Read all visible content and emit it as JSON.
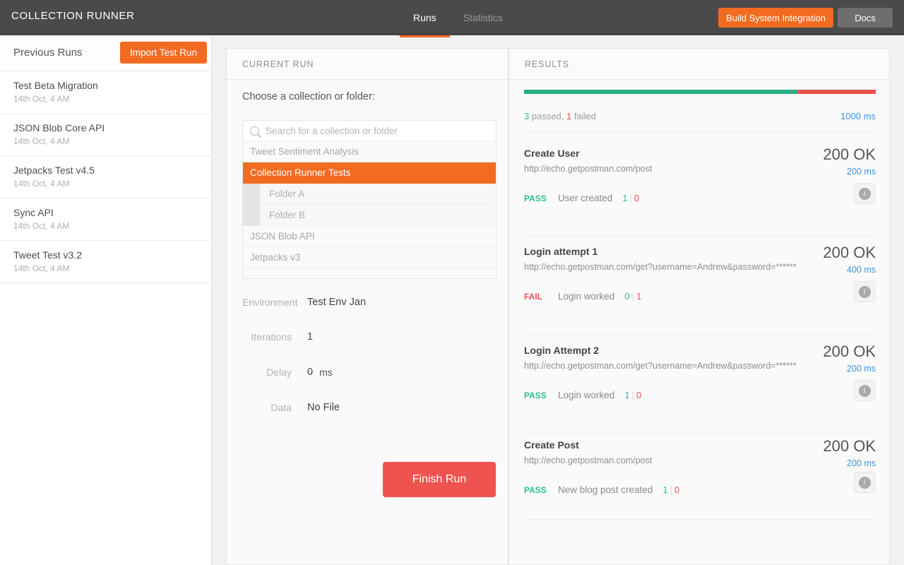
{
  "app": {
    "title": "COLLECTION RUNNER"
  },
  "header": {
    "tabs": [
      {
        "label": "Runs",
        "active": true
      },
      {
        "label": "Statistics",
        "active": false
      }
    ],
    "build_button": "Build System Integration",
    "docs_button": "Docs",
    "accent_color": "#f26b21",
    "background_color": "#4a4a4a"
  },
  "sidebar": {
    "title": "Previous Runs",
    "import_button": "Import Test Run",
    "runs": [
      {
        "name": "Test Beta Migration",
        "date": "14th Oct, 4 AM"
      },
      {
        "name": "JSON Blob Core API",
        "date": "14th Oct, 4 AM"
      },
      {
        "name": "Jetpacks Test v4.5",
        "date": "14th Oct, 4 AM"
      },
      {
        "name": "Sync API",
        "date": "14th Oct, 4 AM"
      },
      {
        "name": "Tweet Test v3.2",
        "date": "14th Oct, 4 AM"
      }
    ]
  },
  "current_run": {
    "panel_title": "CURRENT RUN",
    "choose_label": "Choose a collection or folder:",
    "search_placeholder": "Search for a collection or folder",
    "search_value": "",
    "collections": [
      {
        "label": "Tweet Sentiment Analysis",
        "type": "collection",
        "selected": false
      },
      {
        "label": "Collection Runner Tests",
        "type": "collection",
        "selected": true
      },
      {
        "label": "Folder A",
        "type": "folder",
        "selected": false
      },
      {
        "label": "Folder B",
        "type": "folder",
        "selected": false
      },
      {
        "label": "JSON Blob API",
        "type": "collection",
        "selected": false
      },
      {
        "label": "Jetpacks v3",
        "type": "collection",
        "selected": false
      }
    ],
    "fields": [
      {
        "label": "Environment",
        "value": "Test Env Jan",
        "unit": ""
      },
      {
        "label": "Iterations",
        "value": "1",
        "unit": ""
      },
      {
        "label": "Delay",
        "value": "0",
        "unit": "ms"
      },
      {
        "label": "Data",
        "value": "No File",
        "unit": ""
      }
    ],
    "finish_button": "Finish Run",
    "finish_button_color": "#ef5350"
  },
  "results": {
    "panel_title": "RESULTS",
    "summary": {
      "passed_count": "3",
      "passed_label": "passed,",
      "failed_count": "1",
      "failed_label": "failed",
      "total_time": "1000 ms",
      "pass_percent": 78,
      "fail_percent": 22,
      "pass_color": "#27ae83",
      "fail_color": "#e8524a"
    },
    "items": [
      {
        "name": "Create User",
        "url": "http://echo.getpostman.com/post",
        "status": "200 OK",
        "time": "200 ms",
        "verdict": "PASS",
        "test_description": "User created",
        "pass_count": "1",
        "fail_count": "0",
        "info_icon": "info-icon"
      },
      {
        "name": "Login attempt 1",
        "url": "http://echo.getpostman.com/get?username=Andrew&password=******",
        "status": "200 OK",
        "time": "400 ms",
        "verdict": "FAIL",
        "test_description": "Login worked",
        "pass_count": "0",
        "fail_count": "1",
        "info_icon": "info-icon"
      },
      {
        "name": "Login Attempt 2",
        "url": "http://echo.getpostman.com/get?username=Andrew&password=******",
        "status": "200 OK",
        "time": "200 ms",
        "verdict": "PASS",
        "test_description": "Login worked",
        "pass_count": "1",
        "fail_count": "0",
        "info_icon": "info-icon"
      },
      {
        "name": "Create Post",
        "url": "http://echo.getpostman.com/post",
        "status": "200 OK",
        "time": "200 ms",
        "verdict": "PASS",
        "test_description": "New blog post created",
        "pass_count": "1",
        "fail_count": "0",
        "info_icon": "info-icon"
      }
    ]
  }
}
